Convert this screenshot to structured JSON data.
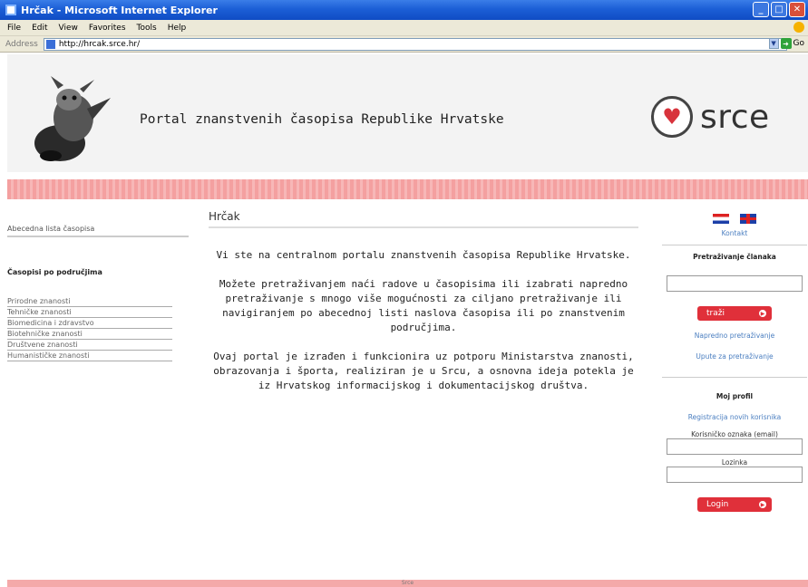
{
  "window": {
    "title": "Hrčak - Microsoft Internet Explorer",
    "menu": [
      "File",
      "Edit",
      "View",
      "Favorites",
      "Tools",
      "Help"
    ],
    "address_label": "Address",
    "address_url": "http://hrcak.srce.hr/",
    "go_label": "Go"
  },
  "header": {
    "portal_title": "Portal znanstvenih časopisa Republike Hrvatske",
    "logo_text": "srce"
  },
  "left_nav": {
    "alphabet_link": "Abecedna lista časopisa",
    "by_field_heading": "Časopisi po područjima",
    "fields": [
      "Prirodne znanosti",
      "Tehničke znanosti",
      "Biomedicina i zdravstvo",
      "Biotehničke znanosti",
      "Društvene znanosti",
      "Humanističke znanosti"
    ]
  },
  "main": {
    "title": "Hrčak",
    "paragraphs": [
      "Vi ste na centralnom portalu znanstvenih časopisa Republike Hrvatske.",
      "Možete pretraživanjem naći radove u časopisima ili izabrati napredno pretraživanje s mnogo više mogućnosti za ciljano pretraživanje ili navigiranjem po abecednoj listi naslova časopisa ili po znanstvenim područjima.",
      "Ovaj portal je izrađen i funkcionira uz potporu Ministarstva znanosti, obrazovanja i športa, realiziran je u Srcu, a osnovna ideja potekla je iz Hrvatskog informacijskog i dokumentacijskog društva."
    ]
  },
  "right": {
    "contact_link": "Kontakt",
    "search_heading": "Pretraživanje članaka",
    "search_button": "traži",
    "advanced_search_link": "Napredno pretraživanje",
    "search_help_link": "Upute za pretraživanje",
    "my_profile_heading": "Moj profil",
    "register_link": "Registracija novih korisnika",
    "username_label": "Korisničko oznaka (email)",
    "password_label": "Lozinka",
    "login_button": "Login"
  },
  "footer": {
    "text": "Srce"
  },
  "colors": {
    "titlebar": "#1c5fd6",
    "band": "#f4a0a0",
    "button": "#e0303a",
    "link": "#4a7ec0"
  }
}
